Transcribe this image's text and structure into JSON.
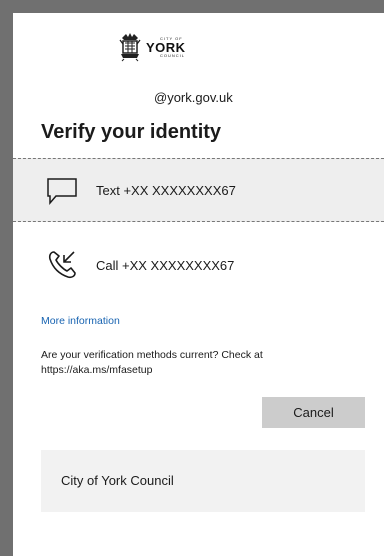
{
  "org_logo": {
    "top_text": "CITY OF",
    "main_text": "YORK",
    "bottom_text": "COUNCIL"
  },
  "account": {
    "email": "@york.gov.uk"
  },
  "page": {
    "title": "Verify your identity"
  },
  "methods": [
    {
      "icon": "chat-bubble-icon",
      "label": "Text +XX XXXXXXXX67",
      "selected": true
    },
    {
      "icon": "phone-call-icon",
      "label": "Call +XX XXXXXXXX67",
      "selected": false
    }
  ],
  "links": {
    "more_info": "More information"
  },
  "notice": {
    "text": "Are your verification methods current? Check at https://aka.ms/mfasetup"
  },
  "buttons": {
    "cancel": "Cancel"
  },
  "footer": {
    "org_name": "City of York Council"
  },
  "colors": {
    "link": "#1763b1",
    "button_bg": "#cccccc",
    "selected_bg": "#eeeeee",
    "backdrop": "#707070"
  }
}
